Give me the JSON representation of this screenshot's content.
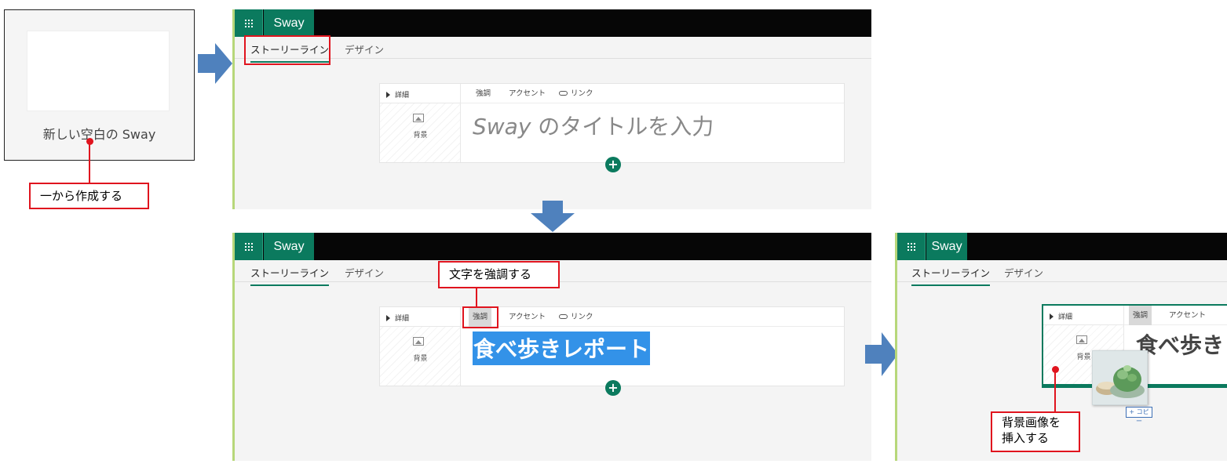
{
  "start": {
    "card_label": "新しい空白の Sway",
    "callout": "一から作成する"
  },
  "app": {
    "name": "Sway",
    "tabs": {
      "storyline": "ストーリーライン",
      "design": "デザイン"
    },
    "card": {
      "details": "詳細",
      "background": "背景",
      "tools": {
        "emphasis": "強調",
        "accent": "アクセント",
        "link": "リンク"
      },
      "plus": "+"
    }
  },
  "panel1": {
    "title_placeholder_italic": "Sway",
    "title_placeholder_rest": " のタイトルを入力"
  },
  "panel2": {
    "title": "食べ歩きレポート",
    "callout": "文字を強調する"
  },
  "panel3": {
    "title_partial": "食べ歩き",
    "copy_tag": "+ コピー",
    "callout_line1": "背景画像を",
    "callout_line2": "挿入する"
  },
  "colors": {
    "brand_green": "#0b7a5e",
    "callout_red": "#e0141e",
    "arrow_blue": "#4f81bd",
    "selection_blue": "#3392e8"
  }
}
